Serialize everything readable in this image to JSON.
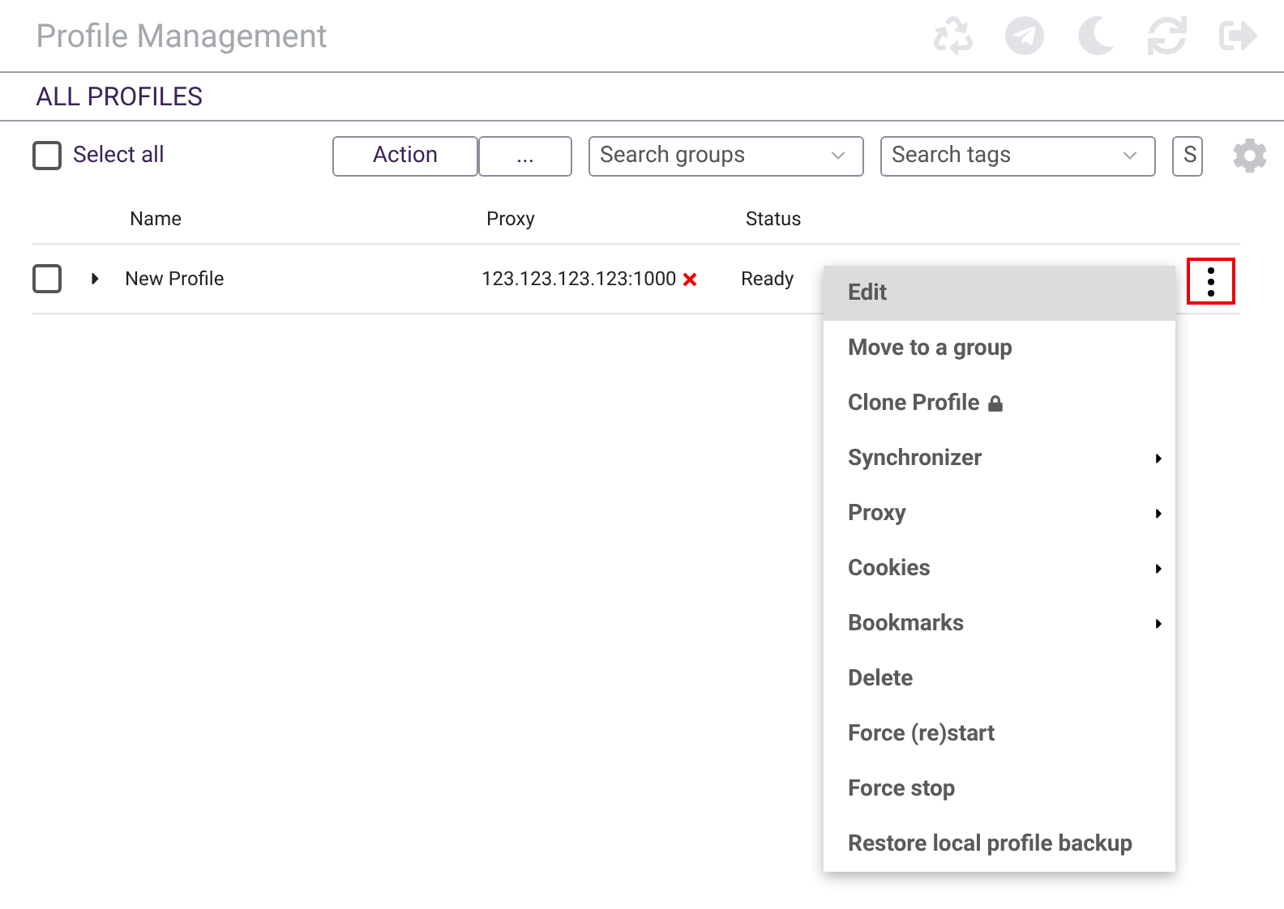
{
  "header": {
    "title": "Profile Management"
  },
  "section": {
    "title": "ALL PROFILES"
  },
  "toolbar": {
    "select_all": {
      "label": "Select all",
      "checked": false
    },
    "buttons": [
      "Action",
      "..."
    ],
    "filters": [
      {
        "placeholder": "Search groups",
        "kind": "dropdown"
      },
      {
        "placeholder": "Search tags",
        "kind": "dropdown"
      },
      {
        "placeholder": "S",
        "kind": "text"
      }
    ]
  },
  "table": {
    "columns": [
      "Name",
      "Proxy",
      "Status"
    ],
    "rows": [
      {
        "checked": false,
        "expanded": false,
        "name": "New Profile",
        "proxy": "123.123.123.123:1000",
        "proxy_ok": false,
        "status": "Ready",
        "menu_open": true
      }
    ]
  },
  "menu": {
    "items": [
      {
        "label": "Edit",
        "kind": "plain",
        "selected": true
      },
      {
        "label": "Move to a group",
        "kind": "plain",
        "selected": false
      },
      {
        "label": "Clone Profile",
        "kind": "locked",
        "selected": false
      },
      {
        "label": "Synchronizer",
        "kind": "submenu",
        "selected": false
      },
      {
        "label": "Proxy",
        "kind": "submenu",
        "selected": false
      },
      {
        "label": "Cookies",
        "kind": "submenu",
        "selected": false
      },
      {
        "label": "Bookmarks",
        "kind": "submenu",
        "selected": false
      },
      {
        "label": "Delete",
        "kind": "plain",
        "selected": false
      },
      {
        "label": "Force (re)start",
        "kind": "plain",
        "selected": false
      },
      {
        "label": "Force stop",
        "kind": "plain",
        "selected": false
      },
      {
        "label": "Restore local profile backup",
        "kind": "plain",
        "selected": false
      }
    ]
  }
}
